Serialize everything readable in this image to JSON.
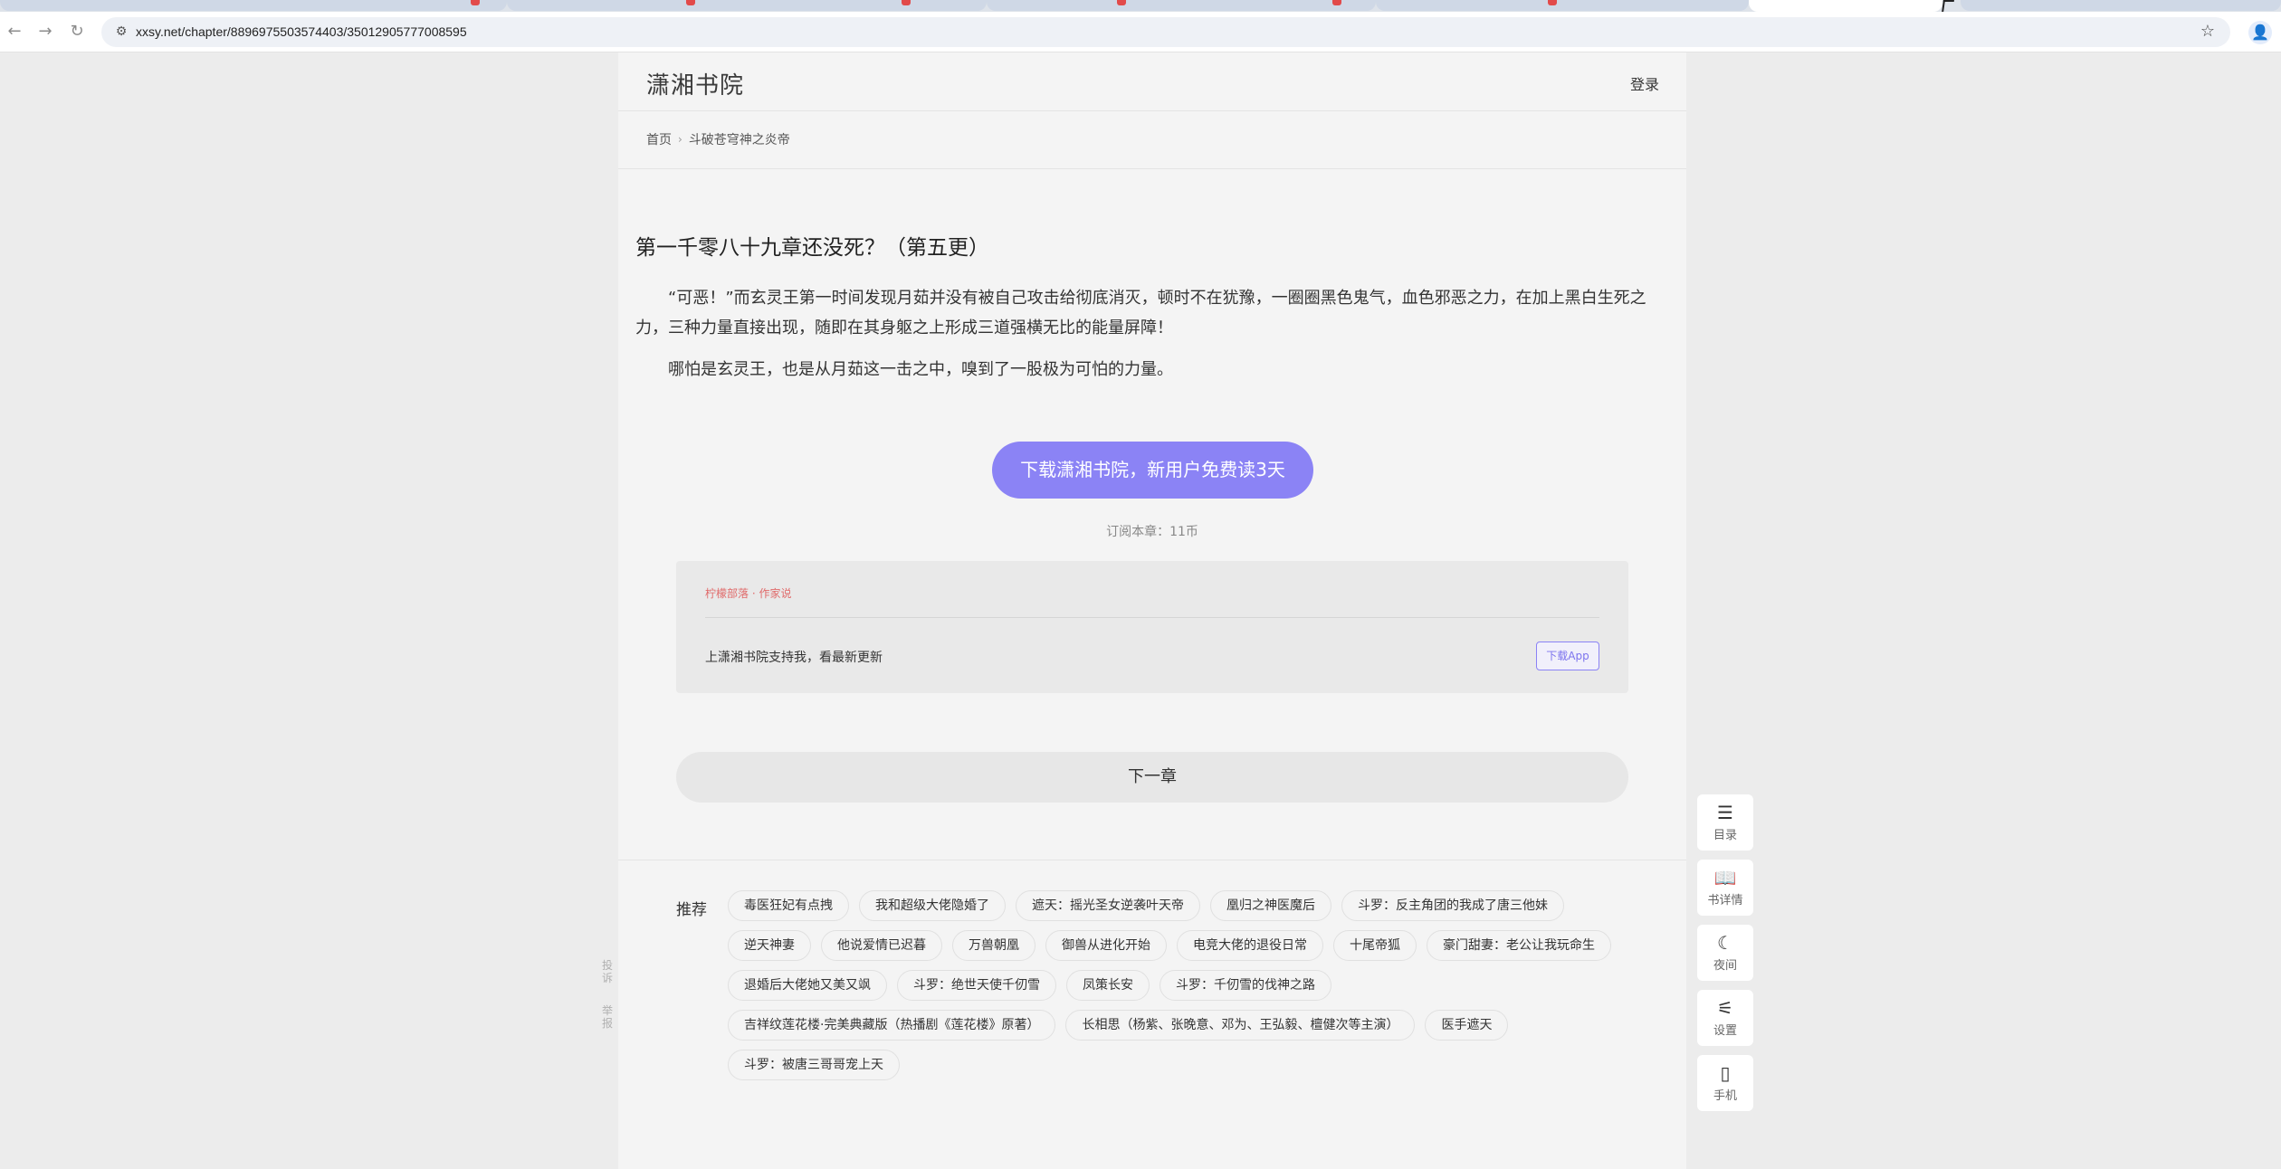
{
  "browser": {
    "url": "xxsy.net/chapter/8896975503574403/35012905777008595",
    "nav_back": "←",
    "nav_forward": "→",
    "nav_reload": "↻",
    "star": "☆",
    "profile": "👤",
    "tune": "⚙"
  },
  "header": {
    "logo": "潇湘书院",
    "login": "登录"
  },
  "breadcrumb": {
    "home": "首页",
    "sep": "›",
    "book": "斗破苍穹神之炎帝"
  },
  "chapter": {
    "title": "第一千零八十九章还没死？（第五更）",
    "paragraphs": [
      "“可恶！”而玄灵王第一时间发现月茹并没有被自己攻击给彻底消灭，顿时不在犹豫，一圈圈黑色鬼气，血色邪恶之力，在加上黑白生死之力，三种力量直接出现，随即在其身躯之上形成三道强横无比的能量屏障！",
      "哪怕是玄灵王，也是从月茹这一击之中，嗅到了一股极为可怕的力量。"
    ]
  },
  "cta": {
    "label": "下载潇湘书院，新用户免费读3天"
  },
  "price": "订阅本章：11币",
  "author_box": {
    "author": "柠檬部落 · 作家说",
    "message": "上潇湘书院支持我，看最新更新",
    "download": "下载App"
  },
  "next_chapter": "下一章",
  "recommend": {
    "label": "推荐",
    "items": [
      "毒医狂妃有点拽",
      "我和超级大佬隐婚了",
      "遮天：摇光圣女逆袭叶天帝",
      "凰归之神医魔后",
      "斗罗：反主角团的我成了唐三他妹",
      "逆天神妻",
      "他说爱情已迟暮",
      "万兽朝凰",
      "御兽从进化开始",
      "电竞大佬的退役日常",
      "十尾帝狐",
      "豪门甜妻：老公让我玩命生",
      "退婚后大佬她又美又飒",
      "斗罗：绝世天使千仞雪",
      "凤策长安",
      "斗罗：千仞雪的伐神之路",
      "吉祥纹莲花楼·完美典藏版（热播剧《莲花楼》原著）",
      "长相思（杨紫、张晚意、邓为、王弘毅、檀健次等主演）",
      "医手遮天",
      "斗罗：被唐三哥哥宠上天"
    ]
  },
  "side_left": {
    "feedback": "投诉",
    "report": "举报"
  },
  "right_tools": [
    {
      "icon": "☰",
      "label": "目录"
    },
    {
      "icon": "📖",
      "label": "书详情"
    },
    {
      "icon": "☾",
      "label": "夜间"
    },
    {
      "icon": "⚟",
      "label": "设置"
    },
    {
      "icon": "▯",
      "label": "手机"
    }
  ]
}
